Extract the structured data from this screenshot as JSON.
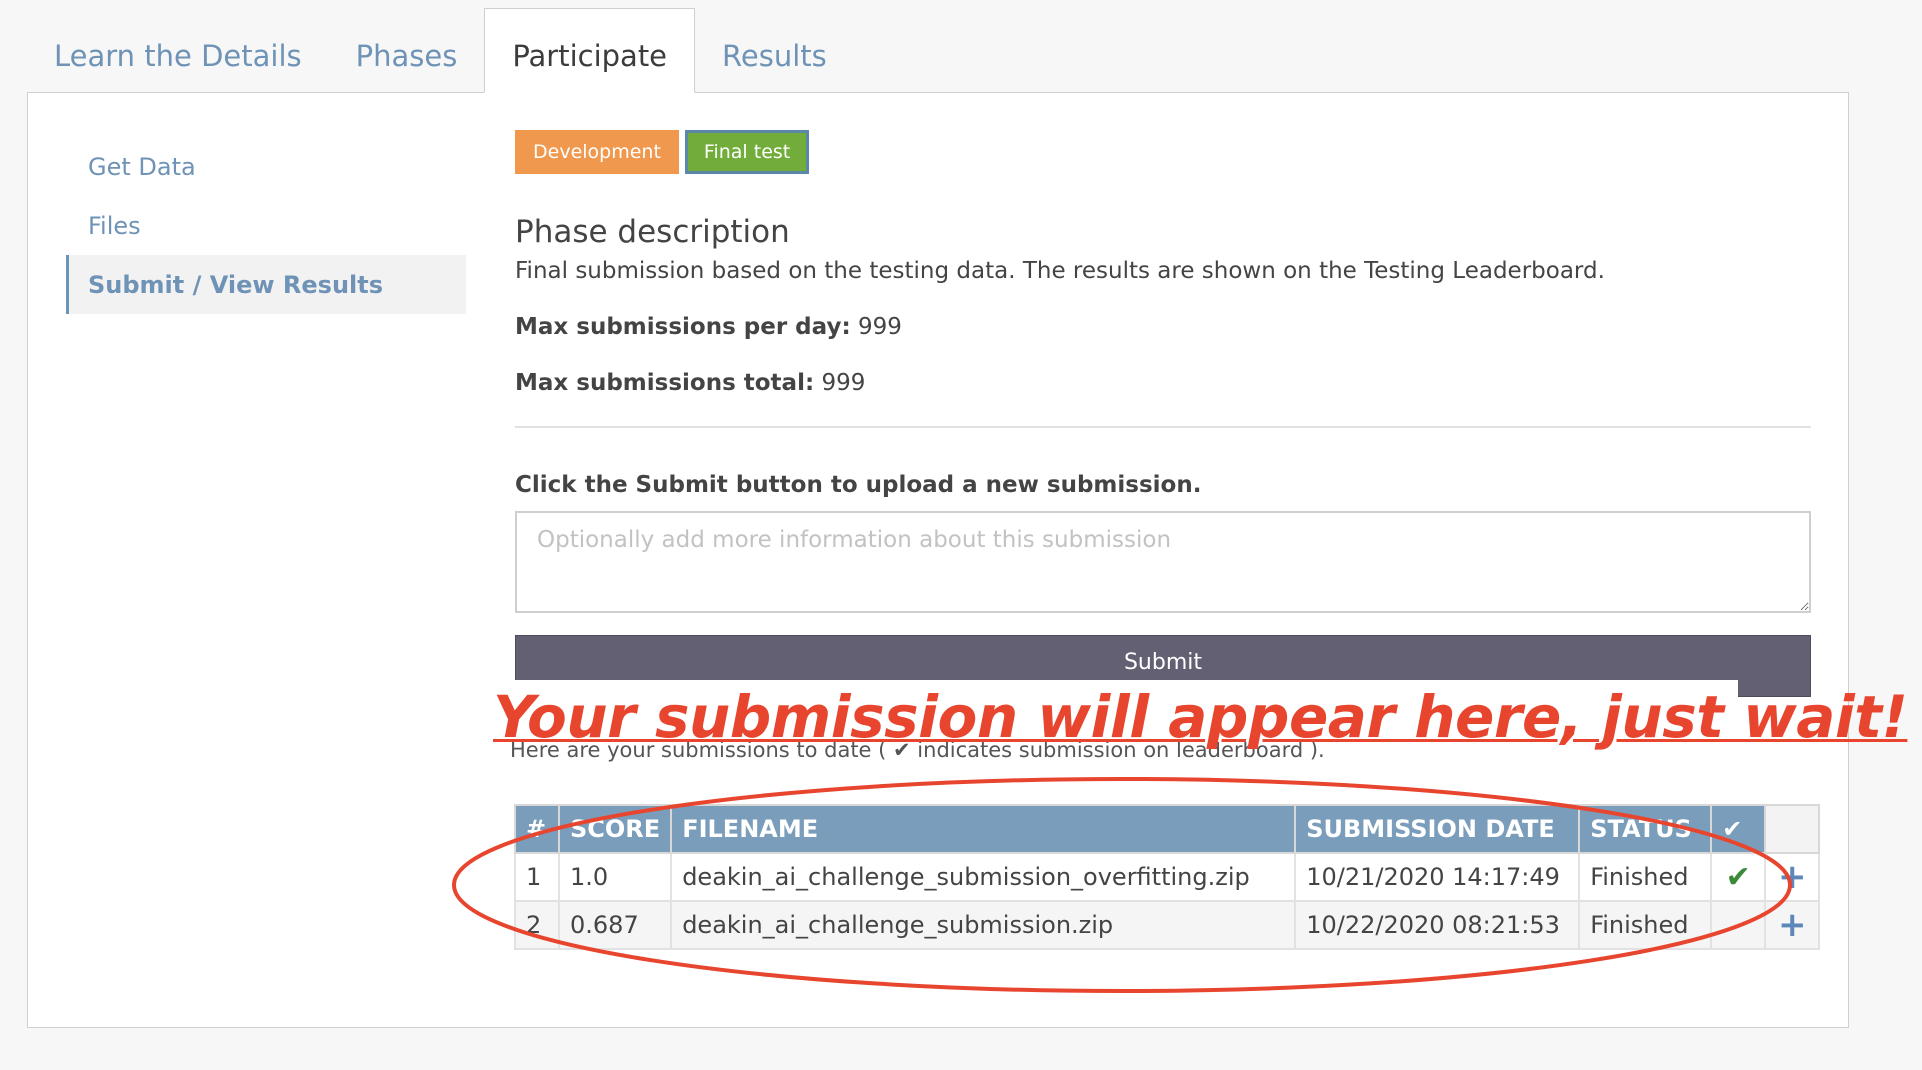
{
  "tabs": [
    {
      "label": "Learn the Details"
    },
    {
      "label": "Phases"
    },
    {
      "label": "Participate"
    },
    {
      "label": "Results"
    }
  ],
  "active_tab": "Participate",
  "sidebar": {
    "items": [
      {
        "label": "Get Data"
      },
      {
        "label": "Files"
      },
      {
        "label": "Submit / View Results"
      }
    ]
  },
  "phase_buttons": [
    {
      "label": "Development",
      "color": "#f0984d"
    },
    {
      "label": "Final test",
      "color": "#72ad3b"
    }
  ],
  "phase": {
    "title": "Phase description",
    "description": "Final submission based on the testing data. The results are shown on the Testing Leaderboard.",
    "max_per_day_label": "Max submissions per day:",
    "max_per_day": "999",
    "max_total_label": "Max submissions total:",
    "max_total": "999"
  },
  "submit": {
    "instruction": "Click the Submit button to upload a new submission.",
    "placeholder": "Optionally add more information about this submission",
    "button_label": "Submit"
  },
  "submissions_note": "Here are your submissions to date ( ✔ indicates submission on leaderboard ).",
  "callout": "Your submission will appear here, just wait!",
  "table": {
    "headers": {
      "index": "#",
      "score": "SCORE",
      "filename": "FILENAME",
      "date": "SUBMISSION DATE",
      "status": "STATUS",
      "leaderboard": "✔"
    },
    "rows": [
      {
        "index": "1",
        "score": "1.0",
        "filename": "deakin_ai_challenge_submission_overfitting.zip",
        "date": "10/21/2020 14:17:49",
        "status": "Finished",
        "on_leaderboard": "✔",
        "action": "+"
      },
      {
        "index": "2",
        "score": "0.687",
        "filename": "deakin_ai_challenge_submission.zip",
        "date": "10/22/2020 08:21:53",
        "status": "Finished",
        "on_leaderboard": "",
        "action": "+"
      }
    ]
  },
  "colors": {
    "accent": "#6e93b6",
    "table_header": "#7a9dbc",
    "submit_button": "#636073",
    "annotation": "#e8452f"
  }
}
